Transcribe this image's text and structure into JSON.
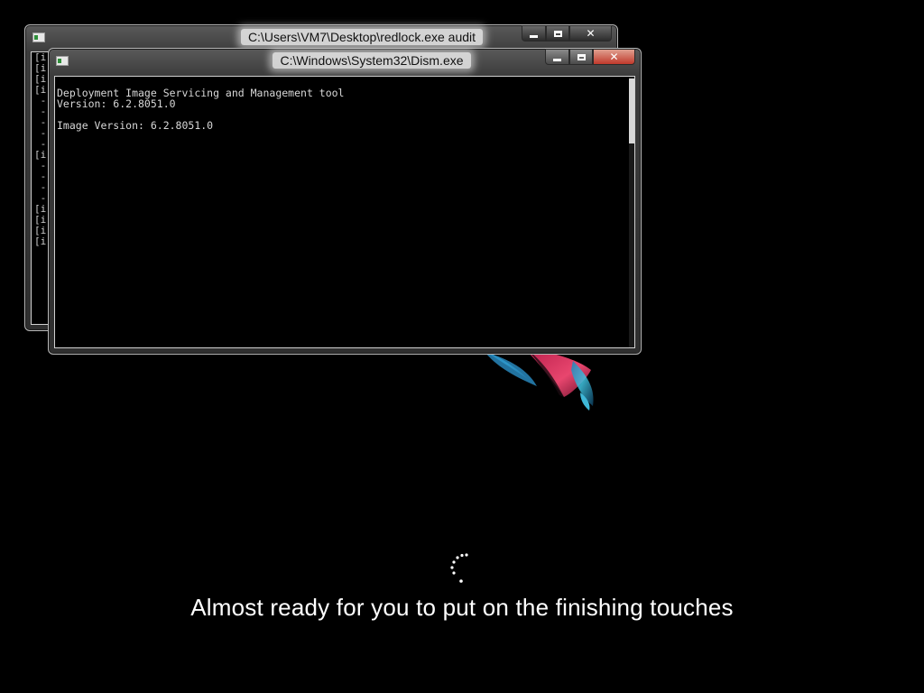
{
  "background_window": {
    "title": "C:\\Users\\VM7\\Desktop\\redlock.exe audit",
    "visible_lines": [
      "[i",
      "[i",
      "[i",
      "[i",
      " -",
      " -",
      " -",
      " -",
      " -",
      "[i",
      " -",
      " -",
      " -",
      " -",
      "[i",
      "[i",
      "[i",
      "[i"
    ]
  },
  "foreground_window": {
    "title": "C:\\Windows\\System32\\Dism.exe",
    "console_lines": [
      "Deployment Image Servicing and Management tool",
      "Version: 6.2.8051.0",
      "",
      "Image Version: 6.2.8051.0"
    ]
  },
  "setup": {
    "status_message": "Almost ready for you to put on the finishing touches"
  },
  "colors": {
    "background": "#000000",
    "console_text": "#d8d8d8",
    "status_text": "#ffffff",
    "close_button": "#c0392b"
  },
  "icons": {
    "window_icon": "console-window-icon",
    "minimize": "minimize-icon",
    "maximize": "maximize-icon",
    "close": "close-icon",
    "spinner": "loading-spinner-icon",
    "fish": "betta-fish-graphic"
  }
}
